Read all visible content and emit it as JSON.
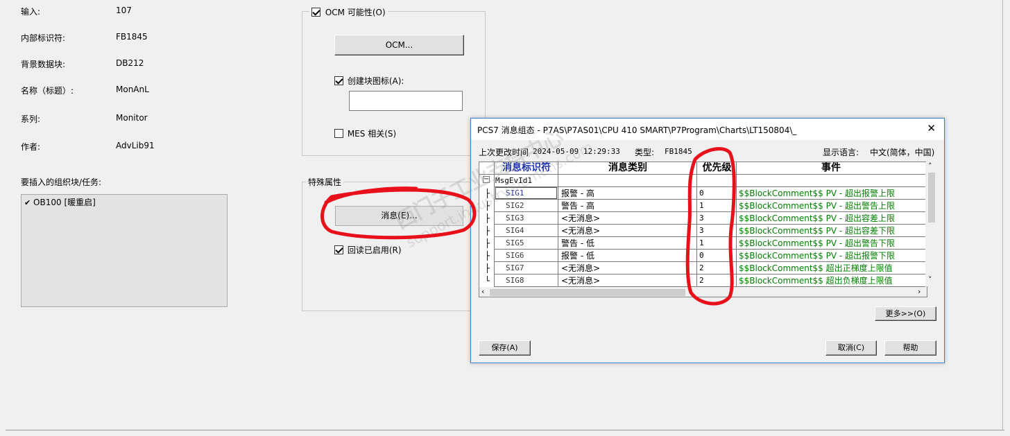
{
  "props": {
    "input_label": "输入:",
    "input_value": "107",
    "internal_id_label": "内部标识符:",
    "internal_id_value": "FB1845",
    "instance_db_label": "背景数据块:",
    "instance_db_value": "DB212",
    "name_label": "名称（标题）:",
    "name_value": "MonAnL",
    "family_label": "系列:",
    "family_value": "Monitor",
    "author_label": "作者:",
    "author_value": "AdvLib91",
    "insert_ob_label": "要插入的组织块/任务:",
    "ob_items": [
      {
        "checked": true,
        "label": "OB100 [暖重启]"
      }
    ]
  },
  "ocm": {
    "group_label": "OCM 可能性(O)",
    "checked": true,
    "button_label": "OCM...",
    "create_icon_label": "创建块图标(A):",
    "create_icon_checked": true,
    "icon_field_value": "",
    "mes_label": "MES 相关(S)",
    "mes_checked": false
  },
  "special": {
    "group_label": "特殊属性",
    "messages_button_label": "消息(E)...",
    "readback_label": "回读已启用(R)",
    "readback_checked": true
  },
  "dialog": {
    "title": "PCS7 消息组态 - P7AS\\P7AS01\\CPU 410 SMART\\P7Program\\Charts\\LT150804\\_",
    "close_glyph": "✕",
    "last_changed_label": "上次更改时间",
    "last_changed_value": "2024-05-09 12:29:33",
    "type_label": "类型:",
    "type_value": "FB1845",
    "display_language_label": "显示语言:",
    "display_language_value": "中文(简体，中国)",
    "columns": {
      "msg_id": "消息标识符",
      "msg_class": "消息类别",
      "priority": "优先级",
      "event": "事件"
    },
    "group_row": "MsgEvId1",
    "rows": [
      {
        "sig": "SIG1",
        "cls": "报警 - 高",
        "prio": "0",
        "event": "$$BlockComment$$ PV - 超出报警上限"
      },
      {
        "sig": "SIG2",
        "cls": "警告 - 高",
        "prio": "1",
        "event": "$$BlockComment$$ PV - 超出警告上限"
      },
      {
        "sig": "SIG3",
        "cls": "<无消息>",
        "prio": "3",
        "event": "$$BlockComment$$ PV - 超出容差上限"
      },
      {
        "sig": "SIG4",
        "cls": "<无消息>",
        "prio": "3",
        "event": "$$BlockComment$$ PV - 超出容差下限"
      },
      {
        "sig": "SIG5",
        "cls": "警告 - 低",
        "prio": "1",
        "event": "$$BlockComment$$ PV - 超出警告下限"
      },
      {
        "sig": "SIG6",
        "cls": "报警 - 低",
        "prio": "0",
        "event": "$$BlockComment$$ PV - 超出报警下限"
      },
      {
        "sig": "SIG7",
        "cls": "<无消息>",
        "prio": "2",
        "event": "$$BlockComment$$ 超出正梯度上限值"
      },
      {
        "sig": "SIG8",
        "cls": "<无消息>",
        "prio": "2",
        "event": "$$BlockComment$$ 超出负梯度上限值"
      }
    ],
    "more_button": "更多>>(O)",
    "save_button": "保存(A)",
    "cancel_button": "取消(C)",
    "help_button": "帮助"
  },
  "watermark": {
    "line1": "西门子工业支持中心",
    "line2": "support.industry.siemens.com"
  },
  "colors": {
    "annotation_red": "#e8101a",
    "event_green": "#008000",
    "dialog_border": "#3b7fc4"
  }
}
